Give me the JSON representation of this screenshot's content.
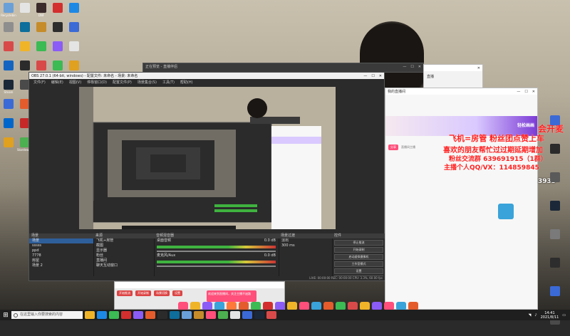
{
  "desktop_icons": [
    {
      "label": "Recyclebin",
      "color": "#6aa0d8"
    },
    {
      "label": "",
      "color": "#e4e4e4"
    },
    {
      "label": "DNF",
      "color": "#3b2b2b"
    },
    {
      "label": "",
      "color": "#d32f2f"
    },
    {
      "label": "",
      "color": "#1e88e5"
    },
    {
      "label": "",
      "color": "#8e8e8e"
    },
    {
      "label": "",
      "color": "#0e6e9c"
    },
    {
      "label": "",
      "color": "#c68c2a"
    },
    {
      "label": "",
      "color": "#2d2d2d"
    },
    {
      "label": "",
      "color": "#3b6ad6"
    },
    {
      "label": "",
      "color": "#d84a4a"
    },
    {
      "label": "",
      "color": "#f0b429"
    },
    {
      "label": "",
      "color": "#3cba54"
    },
    {
      "label": "",
      "color": "#8b5cf6"
    },
    {
      "label": "",
      "color": "#e4e4e4"
    },
    {
      "label": "",
      "color": "#1565c0"
    },
    {
      "label": "",
      "color": "#2b2b2b"
    },
    {
      "label": "",
      "color": "#d84a4a"
    },
    {
      "label": "",
      "color": "#3cba54"
    },
    {
      "label": "",
      "color": "#e0a020"
    },
    {
      "label": "Steam",
      "color": "#1b2838"
    },
    {
      "label": "",
      "color": "#4a4a4a"
    },
    {
      "label": "",
      "color": "#e4e4e4"
    },
    {
      "label": "",
      "color": "#d32f2f"
    },
    {
      "label": "",
      "color": "#0e6e9c"
    },
    {
      "label": "",
      "color": "#3b6ad6"
    },
    {
      "label": "",
      "color": "#e45c2c"
    },
    {
      "label": "",
      "color": "#2b2b2b"
    },
    {
      "label": "",
      "color": "#d8d8d8"
    },
    {
      "label": "",
      "color": "#1e88e5"
    },
    {
      "label": "",
      "color": "#0066cc"
    },
    {
      "label": "",
      "color": "#c62828"
    },
    {
      "label": "",
      "color": "#2d2d2d"
    },
    {
      "label": "",
      "color": "#3cba54"
    },
    {
      "label": "",
      "color": "#8b5cf6"
    },
    {
      "label": "",
      "color": "#e0a020"
    },
    {
      "label": "Stardew Valley",
      "color": "#4caf50"
    },
    {
      "label": "",
      "color": "#6aa0d8"
    }
  ],
  "obs": {
    "title": "OBS 27.0.1 (64-bit, windows) - 配置文件: 未命名 - 场景: 未命名",
    "menu": [
      "文件(F)",
      "编辑(E)",
      "视图(V)",
      "停靠窗口(D)",
      "配置文件(P)",
      "场景集合(S)",
      "工具(T)",
      "帮助(H)"
    ],
    "scenes_title": "场景",
    "scenes": [
      "场景",
      "sssss",
      "ppd",
      "7778",
      "房屋",
      "场景 2"
    ],
    "sources_title": "来源",
    "sources": [
      "飞机+房管",
      "截图",
      "显示器",
      "粉丝",
      "直播间",
      "聊天互动窗口"
    ],
    "mixer_title": "音频混音器",
    "mixer": [
      {
        "name": "桌面音频",
        "db": "0.0 dB"
      },
      {
        "name": "麦克风/Aux",
        "db": "0.0 dB"
      }
    ],
    "transition_title": "场景过渡",
    "transition_type": "淡出",
    "transition_duration": "300 ms",
    "controls_title": "控件",
    "controls": [
      "停止推流",
      "开始录制",
      "启动虚拟摄像机",
      "工作室模式",
      "设置",
      "退出"
    ],
    "status": "LIVE: 00:00:00   REC: 00:00:00   CPU: 3.3%, 60.00 fps"
  },
  "chat": {
    "title": "我的直播间",
    "tag": "分享",
    "host_name": "直播间主播",
    "banner_text": "轻松画画"
  },
  "overlay": {
    "lines": [
      "飞机=房管  粉丝团点赞上车",
      "喜欢的朋友帮忙过过期延期增加",
      "粉丝交流群 639691915（1群）",
      "主播个人QQ/VX：114859845"
    ],
    "side": "会开麦",
    "number": "3933"
  },
  "ghost_window": {
    "title": "",
    "text": "直播"
  },
  "dark_window": {
    "title": "正在预览 - 直播伴侣"
  },
  "lower_window": {
    "title": "",
    "items": [
      "开始推流",
      "开始录制",
      "场景切换",
      "设置"
    ]
  },
  "pink_msg": "欢迎来到直播间，关注主播不迷路",
  "taskbar": {
    "search_placeholder": "在这里输入你要搜索的内容",
    "time": "14:41",
    "date": "2021/8/11",
    "apps": [
      {
        "color": "#f0b429"
      },
      {
        "color": "#1e88e5"
      },
      {
        "color": "#3cba54"
      },
      {
        "color": "#d32f2f"
      },
      {
        "color": "#8b5cf6"
      },
      {
        "color": "#e45c2c"
      },
      {
        "color": "#2b2b2b"
      },
      {
        "color": "#0e6e9c"
      },
      {
        "color": "#6aa0d8"
      },
      {
        "color": "#c68c2a"
      },
      {
        "color": "#ff4f7a"
      },
      {
        "color": "#4caf50"
      },
      {
        "color": "#e4e4e4"
      },
      {
        "color": "#3b6ad6"
      },
      {
        "color": "#1b2838"
      },
      {
        "color": "#d84a4a"
      }
    ]
  },
  "colors": {
    "accent": "#2f5f9b",
    "overlay_red": "#ff1e1e",
    "pink": "#ff4f7a",
    "purple": "#7c3bd6"
  }
}
